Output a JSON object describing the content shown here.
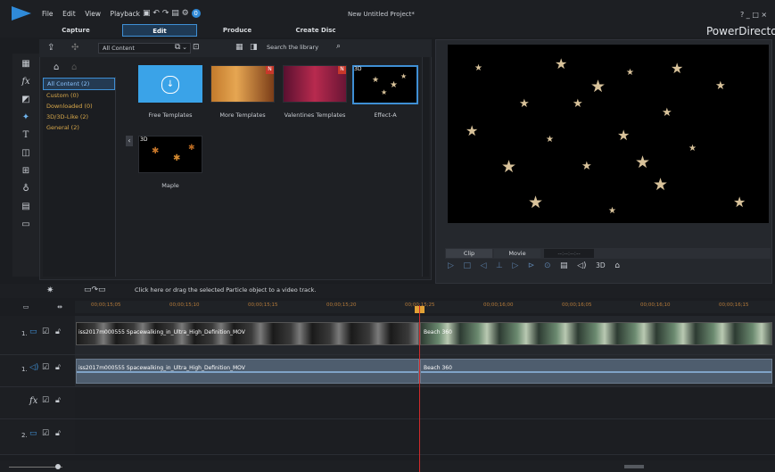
{
  "menu": [
    "File",
    "Edit",
    "View",
    "Playback"
  ],
  "project_title": "New Untitled Project*",
  "app_name": "PowerDirecto",
  "window_controls": "? _ □ ×",
  "mode_tabs": [
    "Capture",
    "Edit",
    "Produce",
    "Create Disc"
  ],
  "library": {
    "filter": "All Content",
    "search_placeholder": "Search the library",
    "categories": [
      "All Content (2)",
      "Custom (0)",
      "Downloaded (0)",
      "3D/3D-Like (2)",
      "General (2)"
    ],
    "items": [
      {
        "label": "Free Templates",
        "badge": ""
      },
      {
        "label": "More Templates",
        "badge": "N"
      },
      {
        "label": "Valentines Templates",
        "badge": "N"
      },
      {
        "label": "Effect-A",
        "badge": "3D"
      },
      {
        "label": "Maple",
        "badge": "3D"
      }
    ]
  },
  "preview": {
    "clip_label": "Clip",
    "movie_label": "Movie",
    "timecode": "--:--:--:--",
    "format": "3D"
  },
  "timeline": {
    "hint": "Click here or drag the selected Particle object to a video track.",
    "timecodes": [
      "00;00;15;05",
      "00;00;15;10",
      "00;00;15;15",
      "00;00;15;20",
      "00;00;15;25",
      "00;00;16;00",
      "00;00;16;05",
      "00;00;16;10",
      "00;00;16;15"
    ],
    "tracks": [
      "1.",
      "1.",
      "fx",
      "2."
    ],
    "video_clip_1": "iss2017m000555 Spacewalking_in_Ultra_High_Definition_MOV",
    "video_clip_2": "Beach 360",
    "audio_clip_1": "iss2017m000555 Spacewalking_in_Ultra_High_Definition_MOV",
    "audio_clip_2": "Beach 360"
  },
  "colors": {
    "accent": "#3f8fd4",
    "category_text": "#d8a84a",
    "playhead": "#d22b2b"
  }
}
